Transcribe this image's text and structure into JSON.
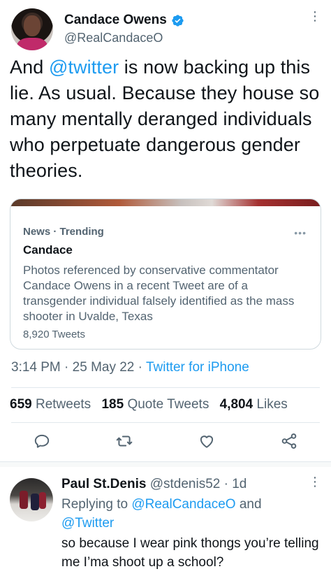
{
  "tweet": {
    "author": {
      "display_name": "Candace Owens",
      "handle": "@RealCandaceO",
      "verified": true
    },
    "text_prefix": "And ",
    "text_mention": "@twitter",
    "text_suffix": " is now backing up this lie. As usual. Because they house so many mentally deranged individuals who perpetuate dangerous gender theories.",
    "card": {
      "meta": "News · Trending",
      "title": "Candace",
      "description": "Photos referenced by conservative commentator Candace Owens in a recent Tweet are of a transgender individual falsely identified as the mass shooter in Uvalde, Texas",
      "count": "8,920 Tweets",
      "menu": "•••"
    },
    "time": "3:14 PM",
    "date": "25 May 22",
    "source": "Twitter for iPhone",
    "separator": " · ",
    "stats": {
      "retweets_count": "659",
      "retweets_label": "Retweets",
      "quotes_count": "185",
      "quotes_label": "Quote Tweets",
      "likes_count": "4,804",
      "likes_label": "Likes"
    },
    "actions": [
      "reply-icon",
      "retweet-icon",
      "like-icon",
      "share-icon"
    ],
    "menu": "⋮"
  },
  "reply": {
    "display_name": "Paul St.Denis",
    "handle": "@stdenis52",
    "time": "1d",
    "replying_to_label": "Replying to ",
    "replying_to_user1": "@RealCandaceO",
    "replying_and": " and",
    "replying_to_user2": "@Twitter",
    "text": "so because I wear pink thongs you’re telling me I’ma shoot up a school?",
    "menu": "⋮"
  },
  "colors": {
    "accent": "#1d9bf0",
    "text": "#0f1419",
    "secondary": "#536471"
  }
}
